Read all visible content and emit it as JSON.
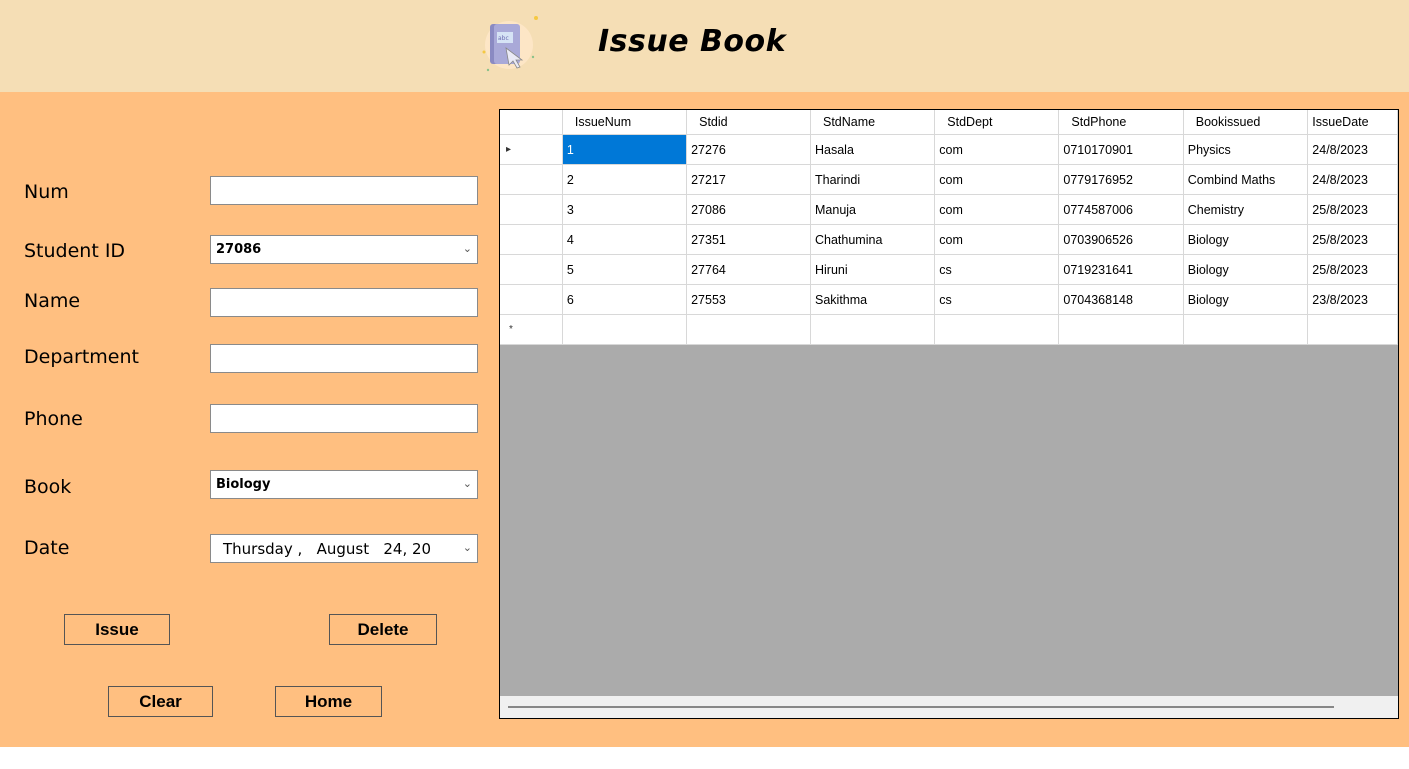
{
  "header": {
    "title": "Issue Book",
    "logo_icon": "book-issue-icon"
  },
  "form": {
    "num_label": "Num",
    "num_value": "",
    "student_id_label": "Student ID",
    "student_id_value": "27086",
    "name_label": "Name",
    "name_value": "",
    "department_label": "Department",
    "department_value": "",
    "phone_label": "Phone",
    "phone_value": "",
    "book_label": "Book",
    "book_value": "Biology",
    "date_label": "Date",
    "date_value": "Thursday ,   August   24, 20"
  },
  "buttons": {
    "issue": "Issue",
    "delete": "Delete",
    "clear": "Clear",
    "home": "Home"
  },
  "grid": {
    "columns": [
      "IssueNum",
      "Stdid",
      "StdName",
      "StdDept",
      "StdPhone",
      "Bookissued",
      "IssueDate"
    ],
    "rows": [
      [
        "1",
        "27276",
        "Hasala",
        "com",
        "0710170901",
        "Physics",
        "24/8/2023"
      ],
      [
        "2",
        "27217",
        "Tharindi",
        "com",
        "0779176952",
        "Combind Maths",
        "24/8/2023"
      ],
      [
        "3",
        "27086",
        "Manuja",
        "com",
        "0774587006",
        "Chemistry",
        "25/8/2023"
      ],
      [
        "4",
        "27351",
        "Chathumina",
        "com",
        "0703906526",
        "Biology",
        "25/8/2023"
      ],
      [
        "5",
        "27764",
        "Hiruni",
        "cs",
        "0719231641",
        "Biology",
        "25/8/2023"
      ],
      [
        "6",
        "27553",
        "Sakithma",
        "cs",
        "0704368148",
        "Biology",
        "23/8/2023"
      ]
    ],
    "current_row_marker": "▸",
    "new_row_marker": "*"
  },
  "colors": {
    "header_bg": "#f5deb5",
    "panel_bg": "#ffbf80",
    "selection": "#0078d7",
    "grid_empty": "#ababab"
  }
}
